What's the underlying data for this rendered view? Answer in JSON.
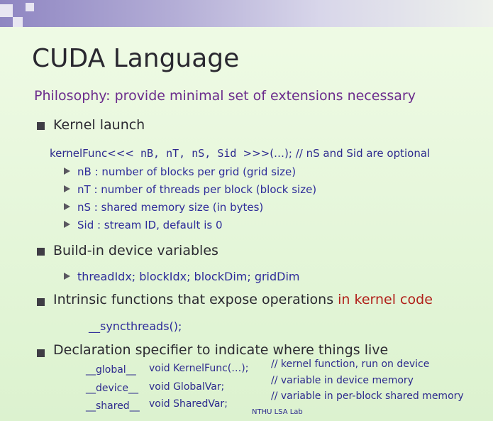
{
  "slide": {
    "title": "CUDA Language",
    "philosophy": "Philosophy: provide minimal set of extensions necessary",
    "kernel_launch": {
      "heading": "Kernel launch",
      "syntax_prefix": "kernelFunc<<<",
      "syntax_args": " nB, nT, nS, Sid ",
      "syntax_suffix": ">>>(…); // nS and Sid are optional",
      "params": [
        "nB : number of blocks per grid (grid size)",
        "nT : number of threads per block (block size)",
        "nS : shared memory size (in bytes)",
        "Sid : stream ID, default is 0"
      ]
    },
    "builtin": {
      "heading": "Build-in device variables",
      "items": "threadIdx; blockIdx; blockDim; gridDim"
    },
    "intrinsic": {
      "heading_plain": "Intrinsic functions that expose operations ",
      "heading_highlight": "in kernel code",
      "example": "__syncthreads();"
    },
    "declaration": {
      "heading": "Declaration specifier to indicate where things live",
      "rows": [
        {
          "spec": "__global__",
          "decl": "void KernelFunc(…);",
          "comment": "// kernel function, run on device"
        },
        {
          "spec": "__device__",
          "decl": "void GlobalVar;",
          "comment": "// variable in device memory"
        },
        {
          "spec": "__shared__",
          "decl": "void SharedVar;",
          "comment": "// variable in per-block shared memory"
        }
      ]
    },
    "footer": "NTHU LSA Lab"
  },
  "colors": {
    "title": "#2a2830",
    "philosophy": "#6b2c8c",
    "code": "#2d2a8e",
    "highlight": "#b1201a",
    "banner": "#8f86c2"
  }
}
